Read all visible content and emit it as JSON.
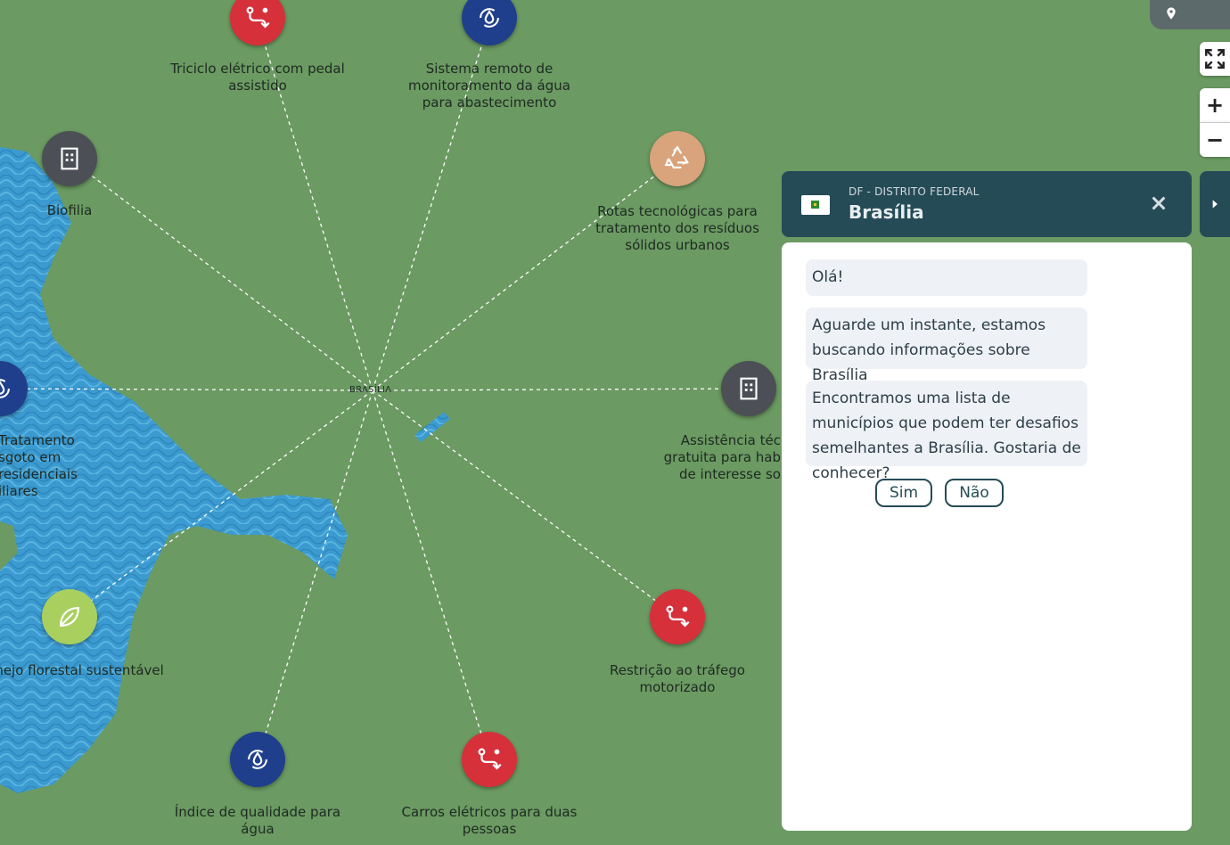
{
  "map": {
    "center_label": "BRASÍLIA",
    "nodes": [
      {
        "id": "triciclo",
        "label": "Triciclo elétrico com pedal assistido",
        "color": "#d6303a",
        "icon": "route-icon"
      },
      {
        "id": "sistema",
        "label": "Sistema remoto de monitoramento da água para abastecimento",
        "color": "#1f3f8c",
        "icon": "water-cycle-icon"
      },
      {
        "id": "biofilia",
        "label": "Biofilia",
        "color": "#4c4f55",
        "icon": "building-icon"
      },
      {
        "id": "rotas",
        "label": "Rotas tecnológicas para tratamento dos resíduos sólidos urbanos",
        "color": "#d9a37c",
        "icon": "recycle-icon"
      },
      {
        "id": "tratamento",
        "label": "Tratamento\nsgoto em\nresidenciais\niliares",
        "color": "#1f3f8c",
        "icon": "water-cycle-icon"
      },
      {
        "id": "assistencia",
        "label": "Assistência téc\ngratuita para hab\nde interesse so",
        "color": "#4c4f55",
        "icon": "building-icon"
      },
      {
        "id": "manejo",
        "label": "Manejo florestal sustentável",
        "color": "#a9cf5e",
        "icon": "leaf-icon"
      },
      {
        "id": "restricao",
        "label": "Restrição ao tráfego motorizado",
        "color": "#d6303a",
        "icon": "route-icon"
      },
      {
        "id": "indice",
        "label": "Índice de qualidade para água",
        "color": "#1f3f8c",
        "icon": "water-cycle-icon"
      },
      {
        "id": "carros",
        "label": "Carros elétricos para duas pessoas",
        "color": "#d6303a",
        "icon": "route-icon"
      }
    ]
  },
  "controls": {
    "zoom_in": "+",
    "zoom_out": "−"
  },
  "panel": {
    "state": "DF - DISTRITO FEDERAL",
    "city": "Brasília",
    "messages": [
      "Olá!",
      "Aguarde um instante, estamos buscando informações sobre Brasília",
      "Encontramos uma lista de municípios que podem ter desafios semelhantes a Brasília. Gostaria de conhecer?"
    ],
    "yes": "Sim",
    "no": "Não"
  }
}
